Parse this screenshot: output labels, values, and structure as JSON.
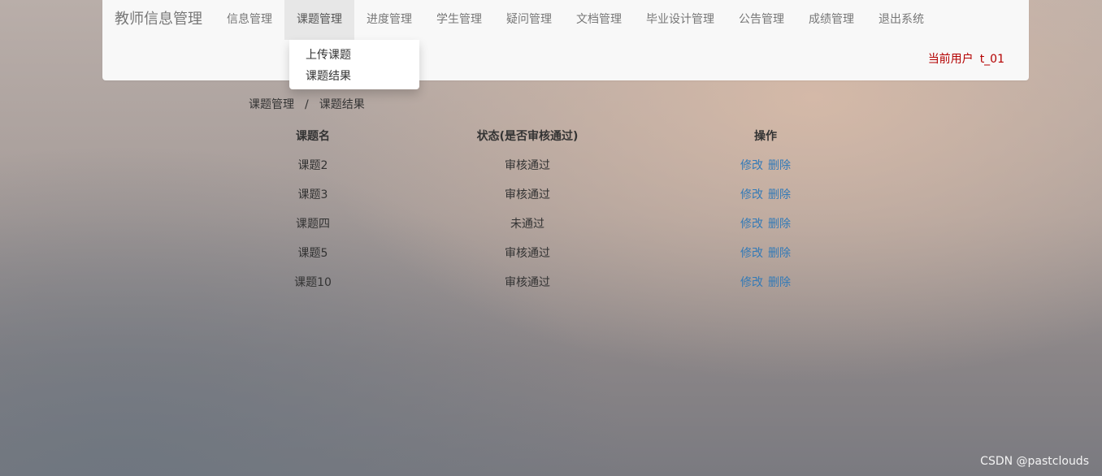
{
  "navbar": {
    "brand": "教师信息管理",
    "items": [
      {
        "label": "信息管理"
      },
      {
        "label": "课题管理"
      },
      {
        "label": "进度管理"
      },
      {
        "label": "学生管理"
      },
      {
        "label": "疑问管理"
      },
      {
        "label": "文档管理"
      },
      {
        "label": "毕业设计管理"
      },
      {
        "label": "公告管理"
      },
      {
        "label": "成绩管理"
      },
      {
        "label": "退出系统"
      }
    ],
    "active_index": 1,
    "user_label": "当前用户",
    "username": "t_01"
  },
  "dropdown": {
    "items": [
      {
        "label": "上传课题"
      },
      {
        "label": "课题结果"
      }
    ]
  },
  "breadcrumb": {
    "items": [
      "课题管理",
      "课题结果"
    ],
    "separator": "/"
  },
  "table": {
    "headers": [
      "课题名",
      "状态(是否审核通过)",
      "操作"
    ],
    "edit_label": "修改",
    "delete_label": "删除",
    "rows": [
      {
        "name": "课题2",
        "status": "审核通过"
      },
      {
        "name": "课题3",
        "status": "审核通过"
      },
      {
        "name": "课题四",
        "status": "未通过"
      },
      {
        "name": "课题5",
        "status": "审核通过"
      },
      {
        "name": "课题10",
        "status": "审核通过"
      }
    ]
  },
  "watermark": "CSDN @pastclouds",
  "colors": {
    "navbar_bg": "#f8f8f8",
    "active_tab_bg": "#e7e7e7",
    "user_text": "#b40000",
    "link": "#337ab7"
  }
}
